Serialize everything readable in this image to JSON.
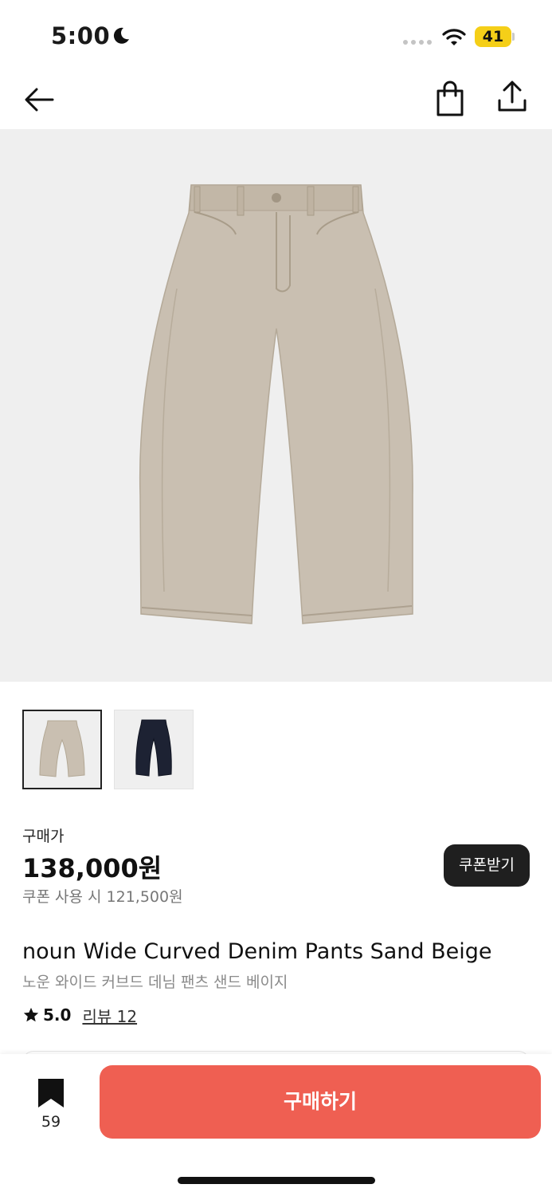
{
  "status_bar": {
    "time": "5:00",
    "battery": "41",
    "icons": [
      "moon-icon",
      "signal-dots-icon",
      "wifi-icon",
      "battery-icon"
    ],
    "battery_color": "#f5cf18"
  },
  "nav": {
    "back_icon": "arrow-left-icon",
    "bag_icon": "shopping-bag-icon",
    "share_icon": "share-icon"
  },
  "hero": {
    "background": "#efefef",
    "product_color": "#c9bfb1"
  },
  "thumbnails": [
    {
      "color_name": "sand-beige",
      "swatch": "#c9bfb1",
      "selected": true
    },
    {
      "color_name": "navy",
      "swatch": "#1d2233",
      "selected": false
    }
  ],
  "price": {
    "label": "구매가",
    "value": "138,000원",
    "coupon_price": "쿠폰 사용 시 121,500원",
    "coupon_button": "쿠폰받기"
  },
  "product": {
    "name": "noun Wide Curved Denim Pants Sand Beige",
    "subname": "노운 와이드 커브드 데님 팬츠 샌드 베이지",
    "rating": "5.0",
    "review_link": "리뷰 12"
  },
  "bottom_bar": {
    "bookmark_count": "59",
    "buy_label": "구매하기",
    "buy_color": "#ef5f52"
  }
}
